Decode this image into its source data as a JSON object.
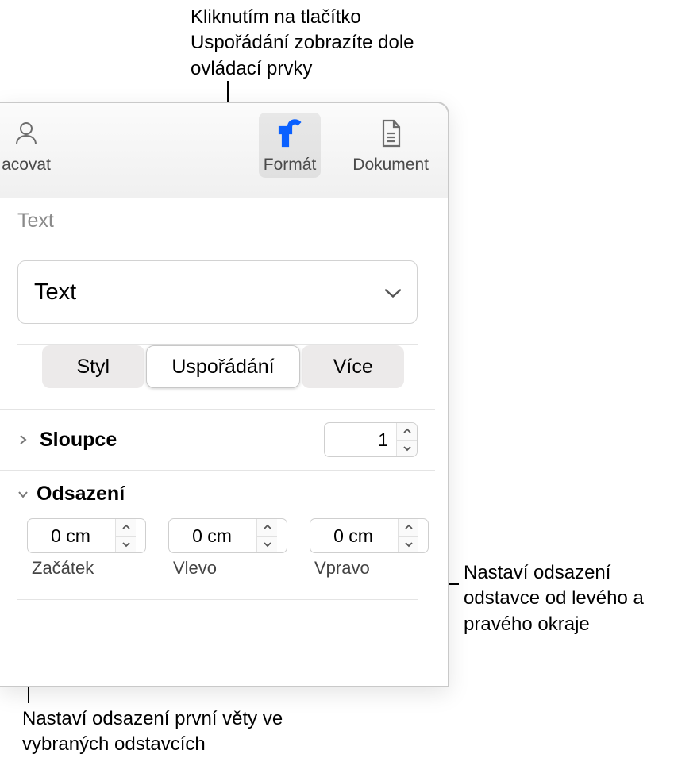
{
  "callouts": {
    "top": "Kliknutím na tlačítko Uspořádání zobrazíte dole ovládací prvky",
    "right": "Nastaví odsazení odstavce od levého a pravého okraje",
    "bottom": "Nastaví odsazení první věty ve vybraných odstavcích"
  },
  "toolbar": {
    "left_item": "acovat",
    "format": "Formát",
    "document": "Dokument"
  },
  "panel": {
    "title": "Text",
    "style_select": "Text",
    "tabs": {
      "style": "Styl",
      "layout": "Uspořádání",
      "more": "Více"
    },
    "columns": {
      "label": "Sloupce",
      "value": "1"
    },
    "indent": {
      "label": "Odsazení",
      "first": {
        "value": "0 cm",
        "label": "Začátek"
      },
      "left": {
        "value": "0 cm",
        "label": "Vlevo"
      },
      "right": {
        "value": "0 cm",
        "label": "Vpravo"
      }
    }
  }
}
